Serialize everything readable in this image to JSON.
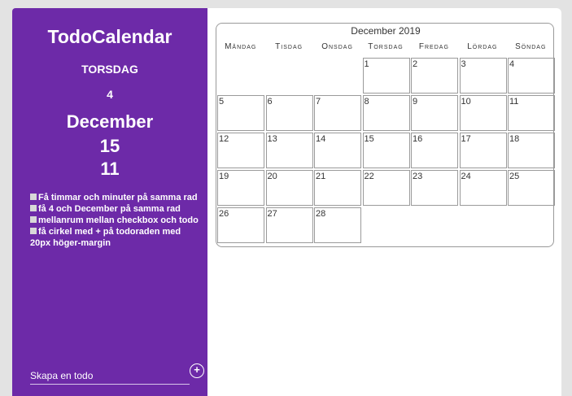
{
  "sidebar": {
    "title": "TodoCalendar",
    "weekday": "TORSDAG",
    "day_number": "4",
    "month": "December",
    "line_15": "15",
    "line_11": "11",
    "todos": [
      "Få timmar och minuter på samma rad",
      "få 4 och December på samma rad",
      "mellanrum mellan checkbox och todo",
      "få cirkel med + på todoraden med 20px höger-margin"
    ],
    "new_todo_placeholder": "Skapa en todo",
    "add_button_label": "+"
  },
  "calendar": {
    "title": "December 2019",
    "weekdays": [
      "Måndag",
      "Tisdag",
      "Onsdag",
      "Torsdag",
      "Fredag",
      "Lördag",
      "Söndag"
    ],
    "first_weekday_index": 3,
    "days": [
      "1",
      "2",
      "3",
      "4",
      "5",
      "6",
      "7",
      "8",
      "9",
      "10",
      "11",
      "12",
      "13",
      "14",
      "15",
      "16",
      "17",
      "18",
      "19",
      "20",
      "21",
      "22",
      "23",
      "24",
      "25",
      "26",
      "27",
      "28"
    ]
  }
}
